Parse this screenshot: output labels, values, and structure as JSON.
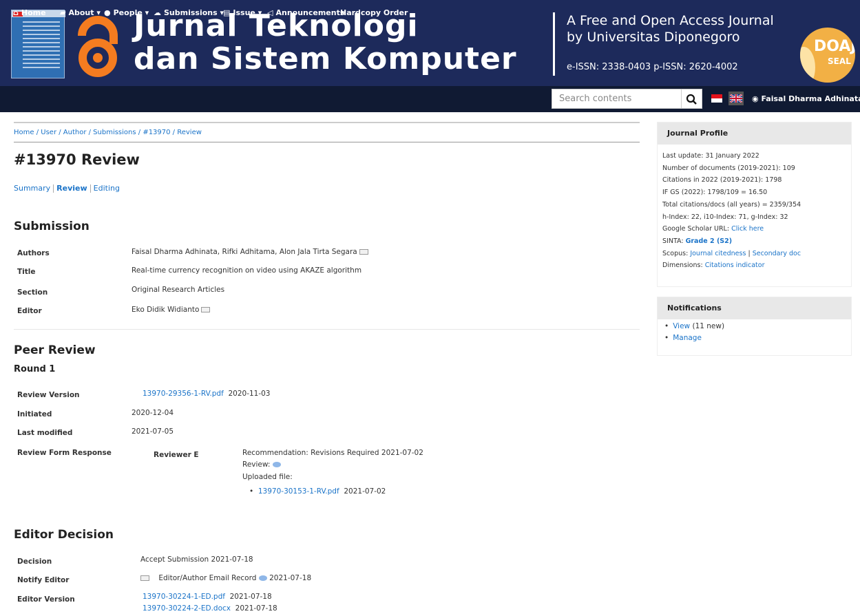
{
  "header": {
    "title_line1": "Jurnal Teknologi",
    "title_line2": "dan Sistem Komputer",
    "tagline_line1": "A Free and Open Access Journal",
    "tagline_line2": "by Universitas Diponegoro",
    "issn": "e-ISSN: 2338-0403  p-ISSN: 2620-4002",
    "doaj_text": "DOAJ",
    "doaj_sub": "SEAL"
  },
  "nav": {
    "items": [
      {
        "label": "Home",
        "icon": "home-icon"
      },
      {
        "label": "About",
        "icon": "book-icon"
      },
      {
        "label": "People",
        "icon": "user-icon"
      },
      {
        "label": "Submissions",
        "icon": "cloud-upload-icon"
      },
      {
        "label": "Issue",
        "icon": "document-icon"
      },
      {
        "label": "Announcements",
        "icon": "bullhorn-icon"
      },
      {
        "label": "Hardcopy Order",
        "icon": ""
      }
    ],
    "search_placeholder": "Search contents",
    "user_name": "Faisal Dharma Adhinata"
  },
  "breadcrumb": "Home / User / Author / Submissions / #13970 / Review",
  "page_title": "#13970 Review",
  "tabs": [
    {
      "label": "Summary"
    },
    {
      "label": "Review"
    },
    {
      "label": "Editing"
    }
  ],
  "submission": {
    "heading": "Submission",
    "rows": [
      {
        "label": "Authors",
        "value": "Faisal Dharma Adhinata, Rifki Adhitama, Alon Jala Tirta Segara"
      },
      {
        "label": "Title",
        "value": "Real-time currency recognition on video using AKAZE algorithm"
      },
      {
        "label": "Section",
        "value": "Original Research Articles"
      },
      {
        "label": "Editor",
        "value": "Eko Didik Widianto"
      }
    ]
  },
  "peer_review": {
    "heading": "Peer Review",
    "round": "Round 1",
    "review_version_label": "Review Version",
    "review_version_file": "13970-29356-1-RV.pdf",
    "review_version_date": "2020-11-03",
    "initiated_label": "Initiated",
    "initiated": "2020-12-04",
    "last_modified_label": "Last modified",
    "last_modified": "2021-07-05",
    "form_response_label": "Review Form Response",
    "reviewer": "Reviewer E",
    "recommendation": "Recommendation: Revisions Required   2021-07-02",
    "review_label": "Review:",
    "uploaded_label": "Uploaded file:",
    "uploaded_file": "13970-30153-1-RV.pdf",
    "uploaded_date": "2021-07-02"
  },
  "editor_decision": {
    "heading": "Editor Decision",
    "decision_label": "Decision",
    "decision": "Accept Submission 2021-07-18",
    "notify_label": "Notify Editor",
    "notify_text": "Editor/Author Email Record",
    "notify_date": "2021-07-18",
    "version_label": "Editor Version",
    "files": [
      {
        "name": "13970-30224-1-ED.pdf",
        "date": "2021-07-18"
      },
      {
        "name": "13970-30224-2-ED.docx",
        "date": "2021-07-18"
      }
    ]
  },
  "journal_profile": {
    "heading": "Journal Profile",
    "lines": [
      "Last update: 31 January 2022",
      "Number of documents (2019-2021): 109",
      "Citations in 2022 (2019-2021): 1798",
      "IF GS (2022): 1798/109 = 16.50",
      "Total citations/docs (all years) = 2359/354",
      "h-Index: 22, i10-Index: 71, g-Index: 32"
    ],
    "gs_label": "Google Scholar URL:",
    "gs_link": "Click here",
    "sinta_label": "SINTA:",
    "sinta_link": "Grade 2 (S2)",
    "scopus_label": "Scopus:",
    "scopus_link1": "Journal citedness",
    "scopus_sep": "|",
    "scopus_link2": "Secondary doc",
    "dimensions_label": "Dimensions:",
    "dimensions_link": "Citations indicator"
  },
  "notifications": {
    "heading": "Notifications",
    "view_label": "View",
    "view_count": "(11 new)",
    "manage_label": "Manage"
  }
}
